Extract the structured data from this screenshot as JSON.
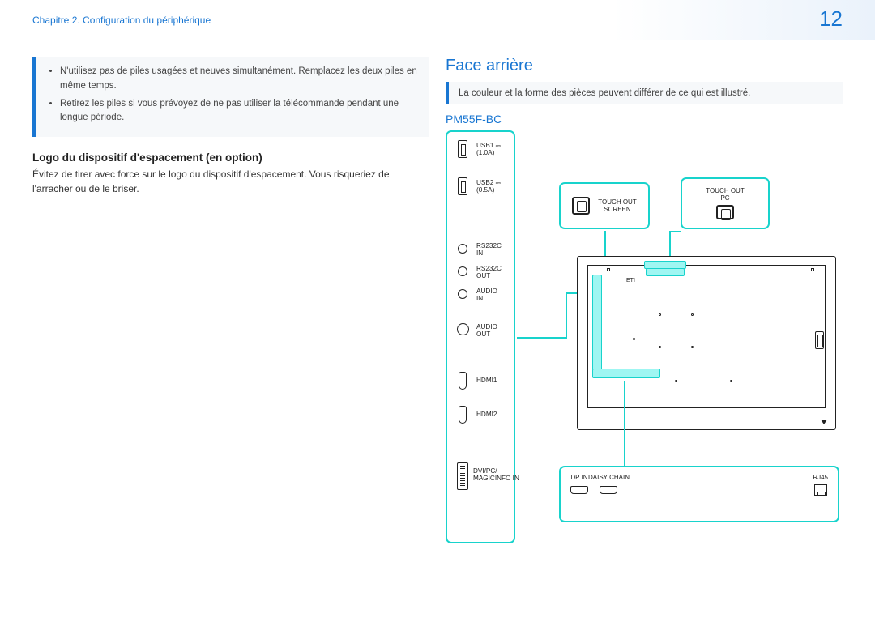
{
  "header": {
    "chapter": "Chapitre 2. Configuration du périphérique",
    "page_number": "12"
  },
  "left": {
    "notes": [
      "N'utilisez pas de piles usagées et neuves simultanément. Remplacez les deux piles en même temps.",
      "Retirez les piles si vous prévoyez de ne pas utiliser la télécommande pendant une longue période."
    ],
    "subhead": "Logo du dispositif d'espacement (en option)",
    "body": "Évitez de tirer avec force sur le logo du dispositif d'espacement. Vous risqueriez de l'arracher ou de le briser."
  },
  "right": {
    "title": "Face arrière",
    "info": "La couleur et la forme des pièces peuvent différer de ce qui est illustré.",
    "model": "PM55F-BC",
    "ports": {
      "usb1": "USB1 ⎓\n(1.0A)",
      "usb2": "USB2 ⎓\n(0.5A)",
      "rs232c_in": "RS232C\nIN",
      "rs232c_out": "RS232C\nOUT",
      "audio_in": "AUDIO\nIN",
      "audio_out": "AUDIO\nOUT",
      "hdmi1": "HDMI1",
      "hdmi2": "HDMI2",
      "dvi": "DVI/PC/\nMAGICINFO IN"
    },
    "callouts": {
      "touch_out_screen": "TOUCH OUT\nSCREEN",
      "touch_out_pc": "TOUCH OUT\nPC",
      "dp_in": "DP IN",
      "daisy_chain": "DAISY CHAIN",
      "rj45": "RJ45"
    }
  }
}
